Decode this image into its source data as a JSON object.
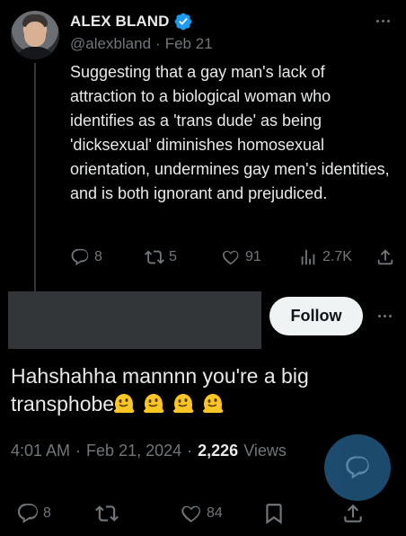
{
  "tweet": {
    "author": {
      "display_name": "ALEX BLAND",
      "handle": "@alexbland",
      "separator": "·",
      "date": "Feb 21",
      "verified": true
    },
    "text": "Suggesting that a gay man's lack of attraction to a biological woman who identifies as a 'trans dude' as being 'dicksexual' diminishes homosexual orientation, undermines gay men's identities, and is both ignorant and prejudiced.",
    "stats": {
      "replies": "8",
      "reposts": "5",
      "likes": "91",
      "views": "2.7K"
    },
    "icons": [
      "reply-icon",
      "repost-icon",
      "like-icon",
      "views-icon",
      "share-icon",
      "more-icon",
      "verified-badge-icon"
    ]
  },
  "reply": {
    "follow_label": "Follow",
    "text": "Hahshahha mannnn you're a big transphobe",
    "emojis": [
      "🫠",
      "🫠",
      "🫠",
      "🫠"
    ],
    "timestamp": "4:01 AM",
    "separator": "·",
    "date": "Feb 21, 2024",
    "views_count": "2,226",
    "views_label": "Views",
    "stats": {
      "replies": "8",
      "reposts": "",
      "likes": "84"
    },
    "icons": [
      "reply-icon",
      "repost-icon",
      "like-icon",
      "bookmark-icon",
      "share-icon",
      "compose-reply-icon"
    ]
  },
  "colors": {
    "background": "#000000",
    "text": "#e7e9ea",
    "muted": "#71767b",
    "verified": "#1d9bf0",
    "fab": "#1d4f73",
    "redacted": "#333639"
  }
}
